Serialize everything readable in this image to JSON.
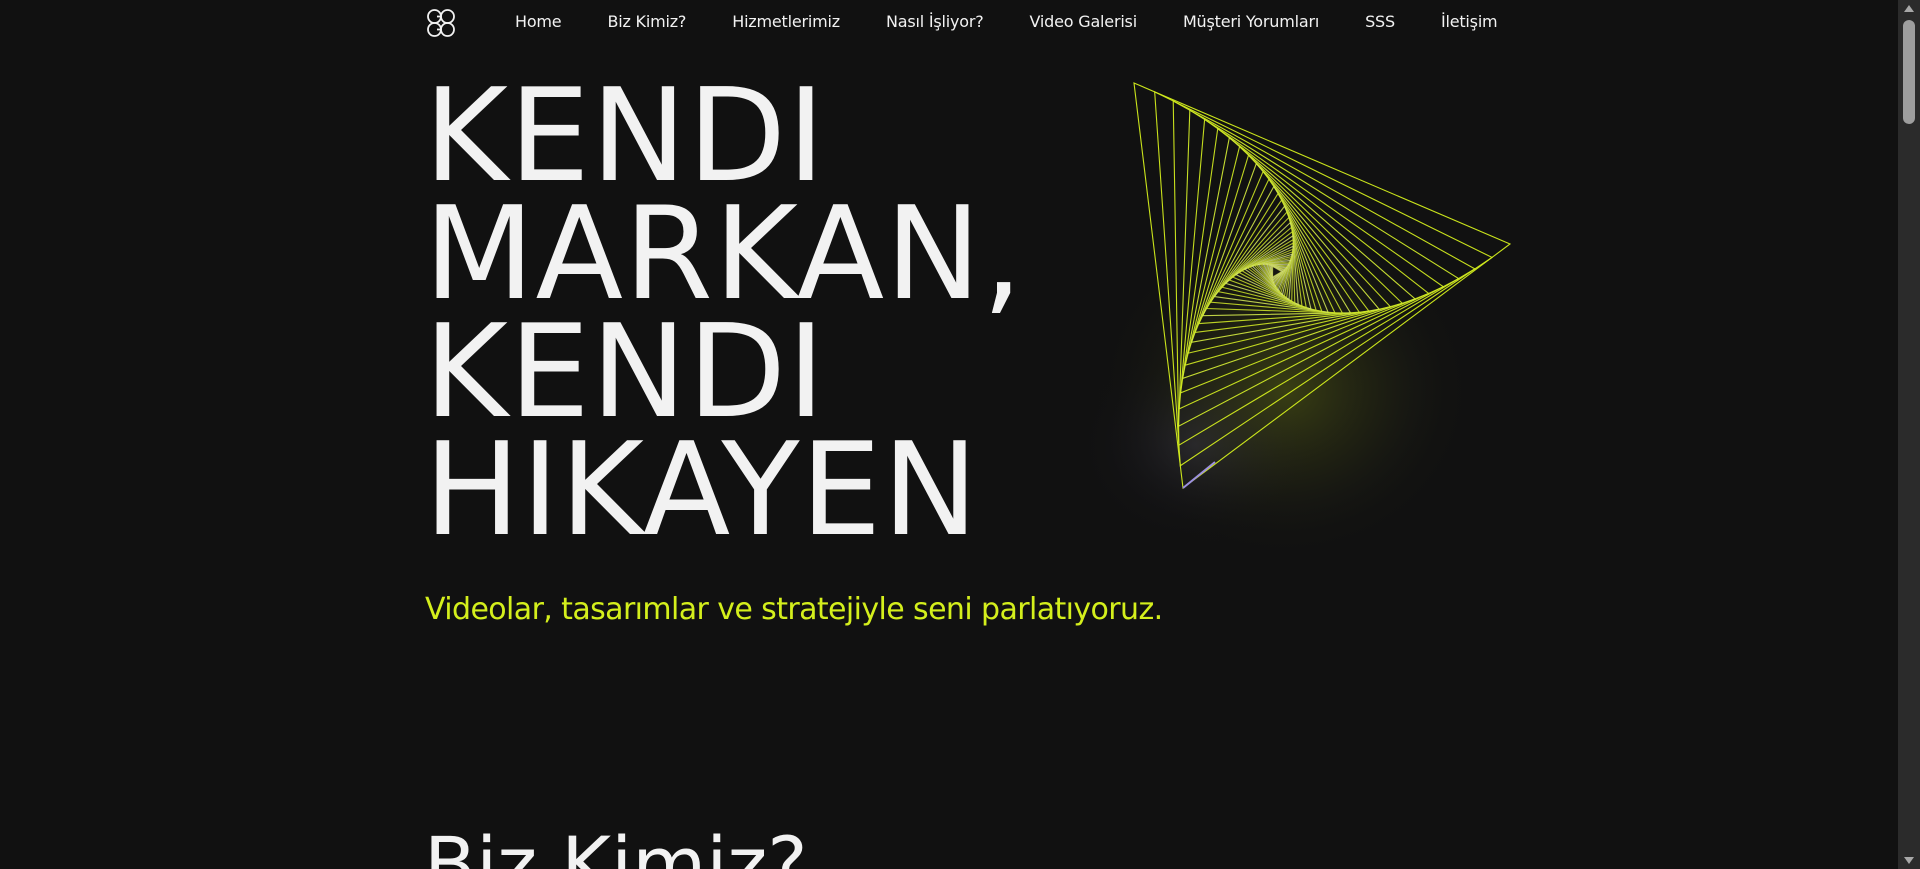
{
  "nav": {
    "logo_icon": "gogo-logo-icon",
    "links": [
      {
        "label": "Home"
      },
      {
        "label": "Biz Kimiz?"
      },
      {
        "label": "Hizmetlerimiz"
      },
      {
        "label": "Nasıl İşliyor?"
      },
      {
        "label": "Video Galerisi"
      },
      {
        "label": "Müşteri Yorumları"
      },
      {
        "label": "SSS"
      },
      {
        "label": "İletişim"
      }
    ]
  },
  "hero": {
    "title_lines": [
      "KENDI",
      "MARKAN,",
      "KENDI",
      "HIKAYEN"
    ],
    "subtitle": "Videolar, tasarımlar ve stratejiyle seni parlatıyoruz.",
    "art_icon": "spiral-play-triangle-icon"
  },
  "about": {
    "title": "Biz Kimiz?"
  },
  "colors": {
    "background": "#111111",
    "text": "#f2f2f2",
    "accent": "#d4ef1c",
    "glow_violet": "#9b8fe0"
  }
}
